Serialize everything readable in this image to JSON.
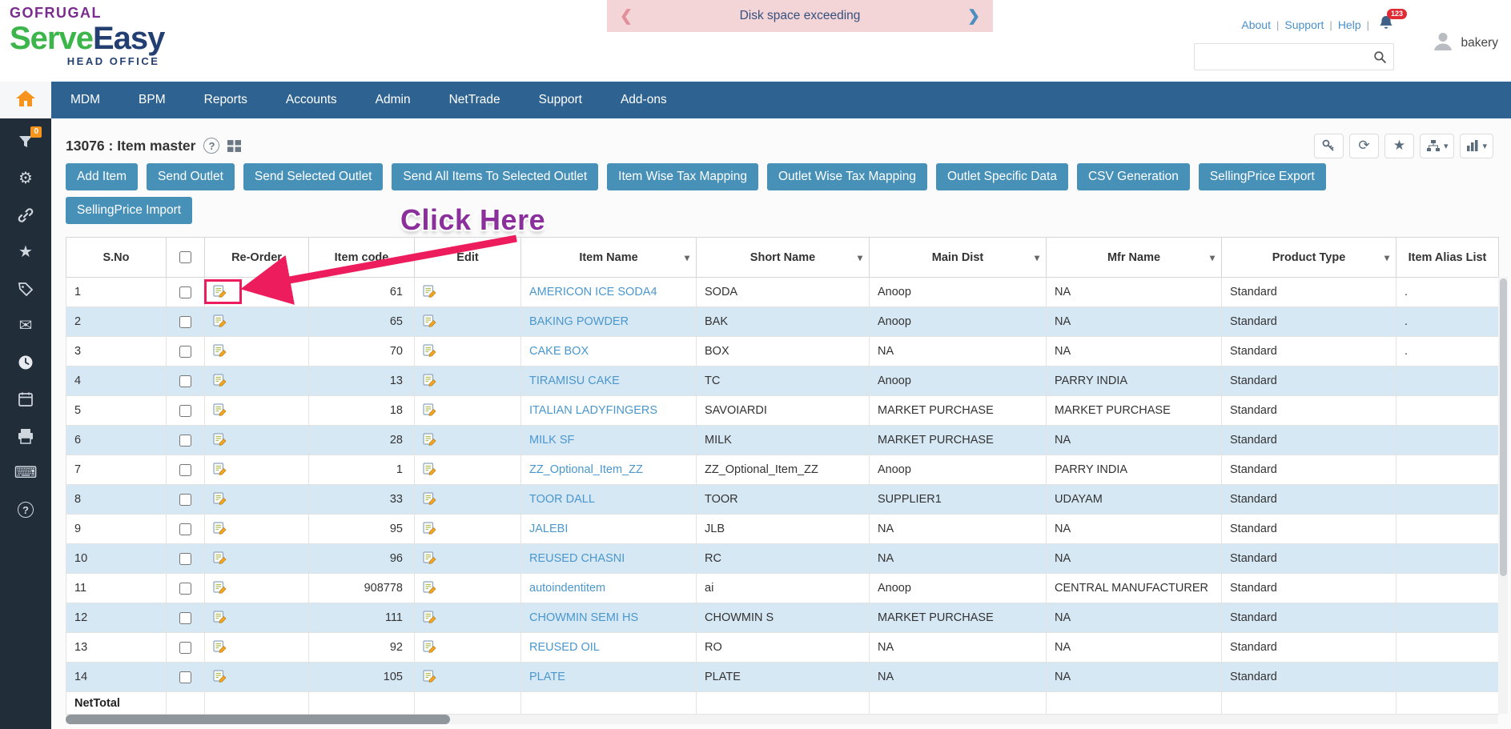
{
  "header": {
    "brand": {
      "gofrugal": "GOFRUGAL",
      "serve": "Serve",
      "easy": "Easy",
      "tagline": "HEAD OFFICE"
    },
    "banner": {
      "text": "Disk space exceeding"
    },
    "links": [
      "About",
      "Support",
      "Help"
    ],
    "notifications_badge": "123",
    "user_name": "bakery"
  },
  "nav": {
    "items": [
      "MDM",
      "BPM",
      "Reports",
      "Accounts",
      "Admin",
      "NetTrade",
      "Support",
      "Add-ons"
    ]
  },
  "sidebar": {
    "filter_badge": "0"
  },
  "page": {
    "title": "13076 : Item master",
    "actions_row1": [
      "Add Item",
      "Send Outlet",
      "Send Selected Outlet",
      "Send All Items To Selected Outlet",
      "Item Wise Tax Mapping",
      "Outlet Wise Tax Mapping",
      "Outlet Specific Data",
      "CSV Generation",
      "SellingPrice Export"
    ],
    "actions_row2": [
      "SellingPrice Import"
    ],
    "annotation": {
      "text": "Click Here"
    }
  },
  "table": {
    "columns": [
      {
        "label": "S.No",
        "sortable": false
      },
      {
        "label": "",
        "type": "checkbox",
        "sortable": false
      },
      {
        "label": "Re-Order",
        "sortable": false
      },
      {
        "label": "Item code",
        "sortable": true
      },
      {
        "label": "Edit",
        "sortable": false
      },
      {
        "label": "Item Name",
        "sortable": true
      },
      {
        "label": "Short Name",
        "sortable": true
      },
      {
        "label": "Main Dist",
        "sortable": true
      },
      {
        "label": "Mfr Name",
        "sortable": true
      },
      {
        "label": "Product Type",
        "sortable": true
      },
      {
        "label": "Item Alias List",
        "sortable": false
      }
    ],
    "rows": [
      {
        "sno": "1",
        "code": "61",
        "name": "AMERICON ICE SODA4",
        "short": "SODA",
        "dist": "Anoop",
        "mfr": "NA",
        "type": "Standard",
        "alias": "."
      },
      {
        "sno": "2",
        "code": "65",
        "name": "BAKING POWDER",
        "short": "BAK",
        "dist": "Anoop",
        "mfr": "NA",
        "type": "Standard",
        "alias": "."
      },
      {
        "sno": "3",
        "code": "70",
        "name": "CAKE BOX",
        "short": "BOX",
        "dist": "NA",
        "mfr": "NA",
        "type": "Standard",
        "alias": "."
      },
      {
        "sno": "4",
        "code": "13",
        "name": "TIRAMISU CAKE",
        "short": "TC",
        "dist": "Anoop",
        "mfr": "PARRY INDIA",
        "type": "Standard",
        "alias": ""
      },
      {
        "sno": "5",
        "code": "18",
        "name": "ITALIAN LADYFINGERS",
        "short": "SAVOIARDI",
        "dist": "MARKET PURCHASE",
        "mfr": "MARKET PURCHASE",
        "type": "Standard",
        "alias": ""
      },
      {
        "sno": "6",
        "code": "28",
        "name": "MILK SF",
        "short": "MILK",
        "dist": "MARKET PURCHASE",
        "mfr": "NA",
        "type": "Standard",
        "alias": ""
      },
      {
        "sno": "7",
        "code": "1",
        "name": "ZZ_Optional_Item_ZZ",
        "short": "ZZ_Optional_Item_ZZ",
        "dist": "Anoop",
        "mfr": "PARRY INDIA",
        "type": "Standard",
        "alias": ""
      },
      {
        "sno": "8",
        "code": "33",
        "name": "TOOR DALL",
        "short": "TOOR",
        "dist": "SUPPLIER1",
        "mfr": "UDAYAM",
        "type": "Standard",
        "alias": ""
      },
      {
        "sno": "9",
        "code": "95",
        "name": "JALEBI",
        "short": "JLB",
        "dist": "NA",
        "mfr": "NA",
        "type": "Standard",
        "alias": ""
      },
      {
        "sno": "10",
        "code": "96",
        "name": "REUSED CHASNI",
        "short": "RC",
        "dist": "NA",
        "mfr": "NA",
        "type": "Standard",
        "alias": ""
      },
      {
        "sno": "11",
        "code": "908778",
        "name": "autoindentitem",
        "short": "ai",
        "dist": "Anoop",
        "mfr": "CENTRAL MANUFACTURER",
        "type": "Standard",
        "alias": ""
      },
      {
        "sno": "12",
        "code": "111",
        "name": "CHOWMIN SEMI HS",
        "short": "CHOWMIN S",
        "dist": "MARKET PURCHASE",
        "mfr": "NA",
        "type": "Standard",
        "alias": ""
      },
      {
        "sno": "13",
        "code": "92",
        "name": "REUSED OIL",
        "short": "RO",
        "dist": "NA",
        "mfr": "NA",
        "type": "Standard",
        "alias": ""
      },
      {
        "sno": "14",
        "code": "105",
        "name": "PLATE",
        "short": "PLATE",
        "dist": "NA",
        "mfr": "NA",
        "type": "Standard",
        "alias": ""
      }
    ],
    "footer_label": "NetTotal"
  },
  "icons": {
    "chevron_left": "❮",
    "chevron_right": "❯",
    "gear": "⚙",
    "star": "★",
    "mail": "✉",
    "keyboard": "⌨",
    "refresh": "⟳",
    "help": "?",
    "sort_caret": "▾"
  },
  "colors": {
    "nav_blue": "#2e6391",
    "sidebar_dark": "#222d3a",
    "button_teal": "#4791b9",
    "row_alt_blue": "#d7e8f5",
    "link_blue": "#4a97cd",
    "annotation_pink": "#ed1c5c",
    "annotation_purple": "#8a2f9b",
    "banner_pink": "#f3d4d7"
  }
}
